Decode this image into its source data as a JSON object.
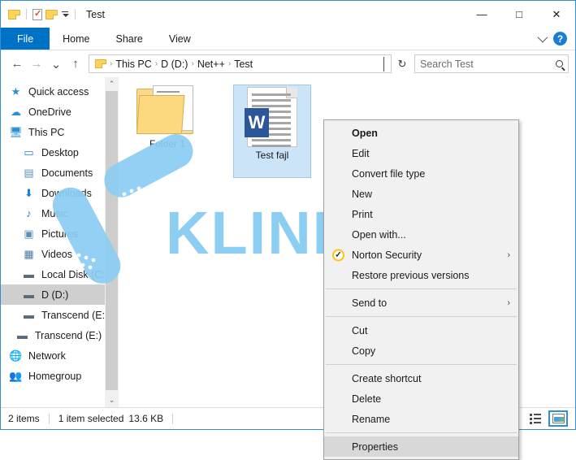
{
  "window": {
    "title": "Test",
    "quick_access": [
      "folder-icon",
      "properties-icon",
      "new-folder-icon",
      "dropdown-caret"
    ],
    "controls": {
      "minimize": "—",
      "maximize": "□",
      "close": "✕"
    },
    "help_icon": "?"
  },
  "ribbon": {
    "tabs": [
      {
        "label": "File",
        "active_file": true
      },
      {
        "label": "Home",
        "active_file": false
      },
      {
        "label": "Share",
        "active_file": false
      },
      {
        "label": "View",
        "active_file": false
      }
    ]
  },
  "address": {
    "back": "←",
    "forward": "→",
    "recent": "⌄",
    "up": "↑",
    "breadcrumbs": [
      "This PC",
      "D (D:)",
      "Net++",
      "Test"
    ],
    "separator": "›",
    "refresh": "↻"
  },
  "search": {
    "placeholder": "Search Test"
  },
  "sidebar": {
    "items": [
      {
        "label": "Quick access",
        "icon": "star-icon",
        "glyph": "★",
        "color": "#2b8fd4",
        "indent": "none",
        "selected": false
      },
      {
        "label": "OneDrive",
        "icon": "cloud-icon",
        "glyph": "☁",
        "color": "#2b8fd4",
        "indent": "none",
        "selected": false
      },
      {
        "label": "This PC",
        "icon": "computer-icon",
        "glyph": "🖥",
        "color": "#2b8fd4",
        "indent": "none",
        "selected": false
      },
      {
        "label": "Desktop",
        "icon": "desktop-icon",
        "glyph": "▭",
        "color": "#1a7fd4",
        "indent": "indent1",
        "selected": false
      },
      {
        "label": "Documents",
        "icon": "documents-icon",
        "glyph": "▤",
        "color": "#5a8fb8",
        "indent": "indent1",
        "selected": false
      },
      {
        "label": "Downloads",
        "icon": "downloads-icon",
        "glyph": "⬇",
        "color": "#1a7fd4",
        "indent": "indent1",
        "selected": false
      },
      {
        "label": "Music",
        "icon": "music-icon",
        "glyph": "♪",
        "color": "#1a7fd4",
        "indent": "indent1",
        "selected": false
      },
      {
        "label": "Pictures",
        "icon": "pictures-icon",
        "glyph": "▣",
        "color": "#5a8fb8",
        "indent": "indent1",
        "selected": false
      },
      {
        "label": "Videos",
        "icon": "videos-icon",
        "glyph": "▦",
        "color": "#4a7aa8",
        "indent": "indent1",
        "selected": false
      },
      {
        "label": "Local Disk (C:)",
        "icon": "drive-icon",
        "glyph": "▬",
        "color": "#5a6a7a",
        "indent": "indent1",
        "selected": false
      },
      {
        "label": "D (D:)",
        "icon": "drive-icon",
        "glyph": "▬",
        "color": "#5a6a7a",
        "indent": "indent1",
        "selected": true
      },
      {
        "label": "Transcend (E:)",
        "icon": "drive-icon",
        "glyph": "▬",
        "color": "#5a6a7a",
        "indent": "indent1",
        "selected": false
      },
      {
        "label": "Transcend (E:)",
        "icon": "drive-icon",
        "glyph": "▬",
        "color": "#5a6a7a",
        "indent": "indent-half",
        "selected": false
      },
      {
        "label": "Network",
        "icon": "network-icon",
        "glyph": "🌐",
        "color": "#2b8fd4",
        "indent": "none",
        "selected": false
      },
      {
        "label": "Homegroup",
        "icon": "homegroup-icon",
        "glyph": "👥",
        "color": "#2b8fd4",
        "indent": "none",
        "selected": false
      }
    ],
    "scroll_up": "⌃",
    "scroll_down": "⌄"
  },
  "files": [
    {
      "name": "Folder 1",
      "type": "folder",
      "selected": false
    },
    {
      "name": "Test fajl",
      "type": "word-document",
      "selected": true,
      "doc_letter": "W"
    }
  ],
  "context_menu": {
    "items": [
      {
        "label": "Open",
        "bold": true,
        "sep_after": false,
        "arrow": false,
        "icon": null,
        "highlighted": false
      },
      {
        "label": "Edit",
        "bold": false,
        "sep_after": false,
        "arrow": false,
        "icon": null,
        "highlighted": false
      },
      {
        "label": "Convert file type",
        "bold": false,
        "sep_after": false,
        "arrow": false,
        "icon": null,
        "highlighted": false
      },
      {
        "label": "New",
        "bold": false,
        "sep_after": false,
        "arrow": false,
        "icon": null,
        "highlighted": false
      },
      {
        "label": "Print",
        "bold": false,
        "sep_after": false,
        "arrow": false,
        "icon": null,
        "highlighted": false
      },
      {
        "label": "Open with...",
        "bold": false,
        "sep_after": false,
        "arrow": false,
        "icon": null,
        "highlighted": false
      },
      {
        "label": "Norton Security",
        "bold": false,
        "sep_after": false,
        "arrow": true,
        "icon": "norton-check-icon",
        "highlighted": false
      },
      {
        "label": "Restore previous versions",
        "bold": false,
        "sep_after": true,
        "arrow": false,
        "icon": null,
        "highlighted": false
      },
      {
        "label": "Send to",
        "bold": false,
        "sep_after": true,
        "arrow": true,
        "icon": null,
        "highlighted": false
      },
      {
        "label": "Cut",
        "bold": false,
        "sep_after": false,
        "arrow": false,
        "icon": null,
        "highlighted": false
      },
      {
        "label": "Copy",
        "bold": false,
        "sep_after": true,
        "arrow": false,
        "icon": null,
        "highlighted": false
      },
      {
        "label": "Create shortcut",
        "bold": false,
        "sep_after": false,
        "arrow": false,
        "icon": null,
        "highlighted": false
      },
      {
        "label": "Delete",
        "bold": false,
        "sep_after": false,
        "arrow": false,
        "icon": null,
        "highlighted": false
      },
      {
        "label": "Rename",
        "bold": false,
        "sep_after": true,
        "arrow": false,
        "icon": null,
        "highlighted": false
      },
      {
        "label": "Properties",
        "bold": false,
        "sep_after": false,
        "arrow": false,
        "icon": null,
        "highlighted": true
      }
    ],
    "submenu_arrow": "›"
  },
  "status": {
    "item_count": "2 items",
    "selection": "1 item selected",
    "size": "13.6 KB"
  },
  "view_buttons": [
    {
      "name": "details-view",
      "active": false
    },
    {
      "name": "large-icons-view",
      "active": true
    }
  ],
  "watermark": {
    "text": "KLINIKA",
    "color": "#8ccdf2"
  }
}
